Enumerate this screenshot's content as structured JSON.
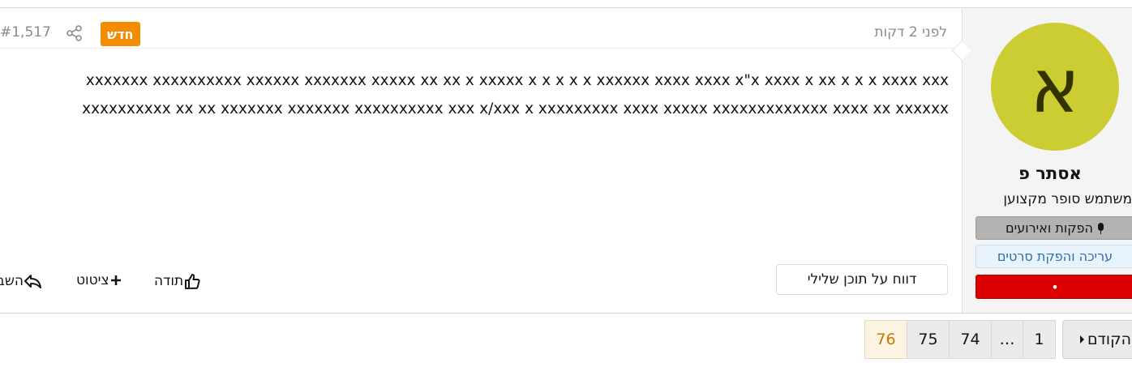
{
  "post": {
    "number": "#1,517",
    "time_ago": "לפני 2 דקות",
    "new_badge": "חדש",
    "body": "xxxxxxx xxxxxxxxxx xxxxxx xxxxxxx xxxxx xx xx x xxxxx x x x x x xxxxxx xxxx xxxx x\"x xxxx x xx x x x xxxx xxx xxxxxxxxxx xx xx xxxxxxx xxxxxxx xxxxxxxxxx xxx x/xxx x xxxxxxxxx xxxx xxxxx xxxxxxxxxxxxx xxxx xx xxxxxx",
    "report_label": "דווח על תוכן שלילי",
    "like_label": "תודה",
    "quote_label": "ציטוט",
    "reply_label": "השב"
  },
  "user": {
    "avatar_letter": "א",
    "avatar_color": "#cccc33",
    "name": "אסתר פ",
    "title": "משתמש סופר מקצוען",
    "banners": [
      {
        "label": "הפקות ואירועים",
        "icon": "mic-icon"
      },
      {
        "label": "עריכה והפקת סרטים"
      },
      {
        "label": "•"
      }
    ]
  },
  "pagination": {
    "prev_label": "הקודם",
    "pages": [
      "1",
      "…",
      "74",
      "75",
      "76"
    ],
    "current": "76"
  }
}
